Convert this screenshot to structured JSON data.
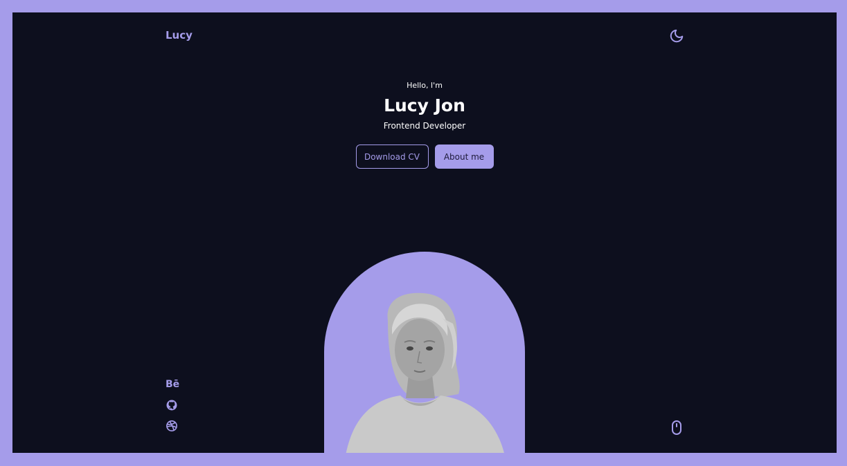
{
  "nav": {
    "logo": "Lucy",
    "theme_icon": "moon-icon"
  },
  "hero": {
    "greeting": "Hello, I'm",
    "name": "Lucy Jon",
    "role": "Frontend Developer",
    "buttons": {
      "download_cv": "Download CV",
      "about_me": "About me"
    }
  },
  "socials": [
    {
      "name": "behance",
      "icon": "behance-icon",
      "text": "Bē"
    },
    {
      "name": "github",
      "icon": "github-icon"
    },
    {
      "name": "dribbble",
      "icon": "dribbble-icon"
    }
  ],
  "scroll": {
    "icon": "mouse-icon"
  },
  "colors": {
    "accent": "#a59cea",
    "background": "#0d0f1e",
    "frame": "#a59cea",
    "text": "#ffffff"
  }
}
